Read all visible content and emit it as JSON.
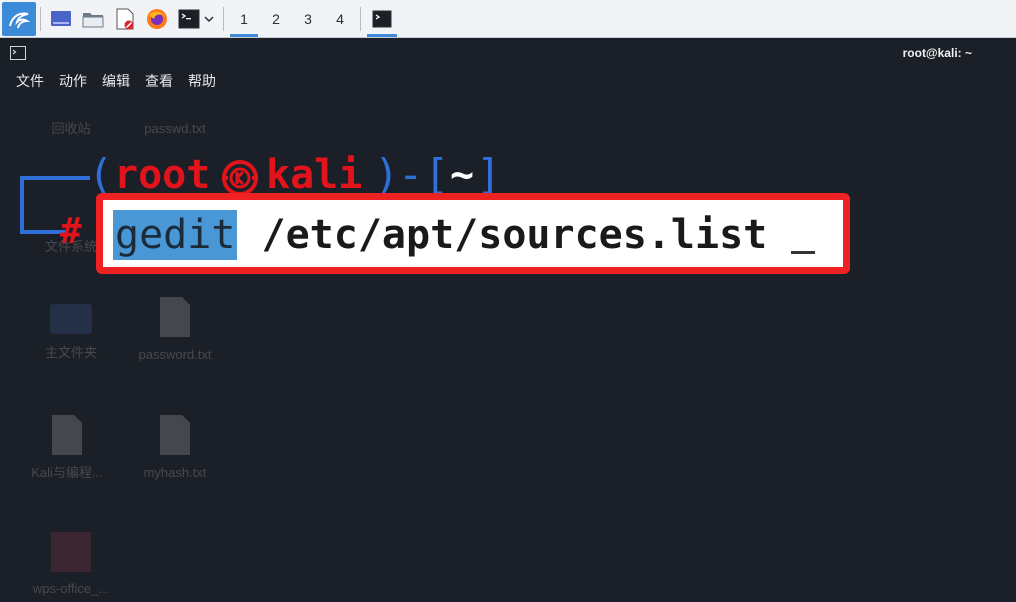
{
  "taskbar": {
    "workspaces": [
      "1",
      "2",
      "3",
      "4"
    ],
    "active_workspace": "1"
  },
  "terminal": {
    "title": "root@kali: ~",
    "menu": [
      "文件",
      "动作",
      "编辑",
      "查看",
      "帮助"
    ]
  },
  "desktop_icons": [
    {
      "label": "回收站"
    },
    {
      "label": "passwd.txt"
    },
    {
      "label": "文件系统"
    },
    {
      "label": "主文件夹"
    },
    {
      "label": "password.txt"
    },
    {
      "label": "Kali与编程..."
    },
    {
      "label": "myhash.txt"
    },
    {
      "label": "wps-office_..."
    }
  ],
  "prompt": {
    "user": "root",
    "host": "kali",
    "dir": "~",
    "symbol": "#"
  },
  "command": {
    "selected": "gedit",
    "rest": " /etc/apt/sources.list "
  },
  "colors": {
    "accent": "#3b8bd9",
    "prompt_red": "#e0141a",
    "prompt_blue": "#2f6fd8",
    "highlight_border": "#ee2222",
    "selection": "#4a97d6"
  }
}
